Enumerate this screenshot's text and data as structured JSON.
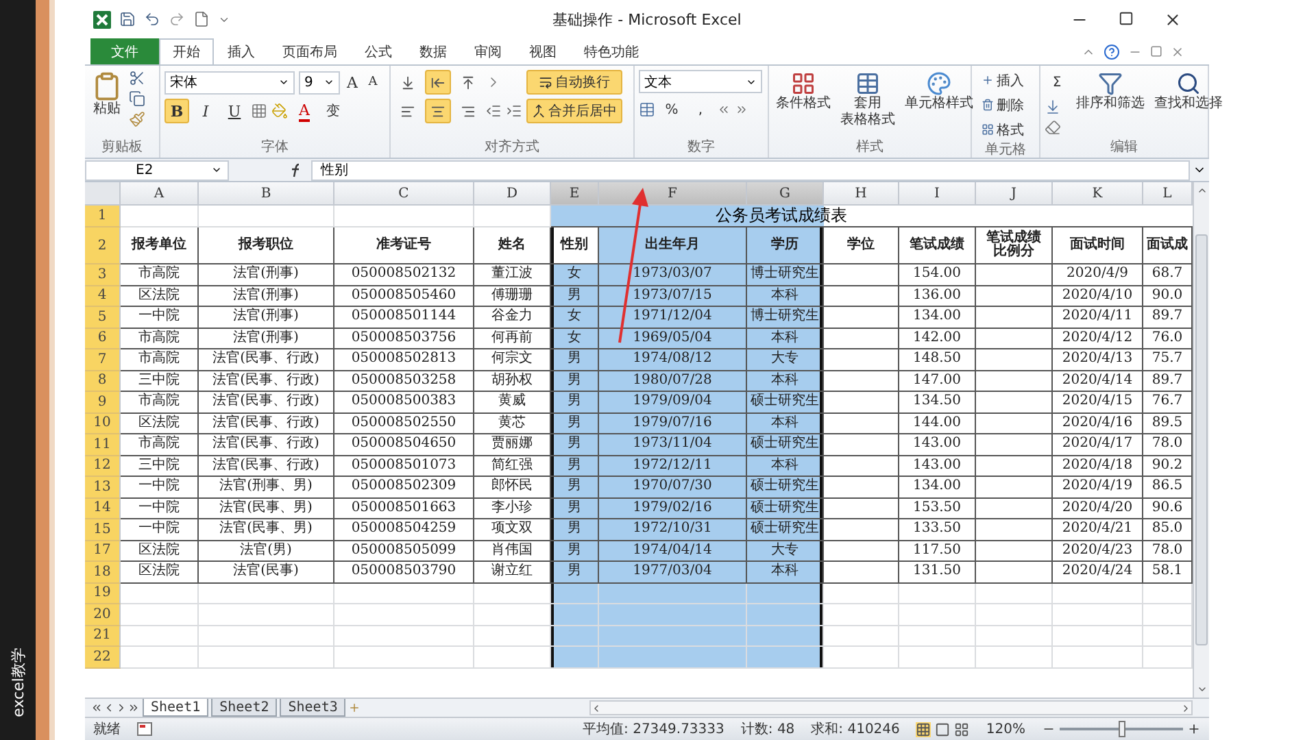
{
  "side_label": "excel教学",
  "window": {
    "title": "基础操作 - Microsoft Excel"
  },
  "ribbon": {
    "tabs": [
      {
        "label": "文件",
        "kind": "file",
        "selected": false
      },
      {
        "label": "开始",
        "kind": "tab",
        "selected": true
      },
      {
        "label": "插入",
        "kind": "tab",
        "selected": false
      },
      {
        "label": "页面布局",
        "kind": "tab",
        "selected": false
      },
      {
        "label": "公式",
        "kind": "tab",
        "selected": false
      },
      {
        "label": "数据",
        "kind": "tab",
        "selected": false
      },
      {
        "label": "审阅",
        "kind": "tab",
        "selected": false
      },
      {
        "label": "视图",
        "kind": "tab",
        "selected": false
      },
      {
        "label": "特色功能",
        "kind": "tab",
        "selected": false
      }
    ],
    "clipboard": {
      "label": "剪贴板",
      "paste": "粘贴"
    },
    "font": {
      "label": "字体",
      "face": "宋体",
      "size": "9",
      "size_buttons": [
        "A",
        "A"
      ],
      "styles": [
        {
          "text": "B",
          "on": true
        },
        {
          "text": "I",
          "on": false
        },
        {
          "text": "U",
          "on": false
        }
      ],
      "font_color": "A",
      "phonetic": "变"
    },
    "alignment": {
      "label": "对齐方式",
      "vertical": [
        {
          "on": false
        },
        {
          "on": true
        },
        {
          "on": false
        }
      ],
      "horizontal": [
        {
          "on": false
        },
        {
          "on": true
        },
        {
          "on": false
        }
      ],
      "wrap": {
        "text": "自动换行",
        "on": true
      },
      "merge": {
        "text": "合并后居中",
        "on": true
      }
    },
    "number": {
      "label": "数字",
      "format": "文本",
      "symbols": [
        "%",
        ","
      ]
    },
    "styles": {
      "label": "样式",
      "buttons": [
        "条件格式",
        [
          "套用",
          "表格格式"
        ],
        "单元格样式"
      ]
    },
    "cells": {
      "label": "单元格",
      "buttons": [
        "插入",
        "删除",
        "格式"
      ]
    },
    "editing": {
      "label": "编辑",
      "sum": "Σ",
      "buttons": [
        "排序和筛选",
        "查找和选择"
      ]
    }
  },
  "formula_bar": {
    "name_box": "E2",
    "formula": "性别"
  },
  "sheet": {
    "columns": [
      {
        "letter": "A",
        "selected": false
      },
      {
        "letter": "B",
        "selected": false
      },
      {
        "letter": "C",
        "selected": false
      },
      {
        "letter": "D",
        "selected": false
      },
      {
        "letter": "E",
        "selected": true,
        "active": true
      },
      {
        "letter": "F",
        "selected": true
      },
      {
        "letter": "G",
        "selected": true
      },
      {
        "letter": "H",
        "selected": false
      },
      {
        "letter": "I",
        "selected": false
      },
      {
        "letter": "J",
        "selected": false
      },
      {
        "letter": "K",
        "selected": false
      },
      {
        "letter": "L",
        "selected": false
      }
    ],
    "rows": [
      {
        "number": "1",
        "selected": true,
        "title": "公务员考试成绩表"
      },
      {
        "number": "2",
        "selected": true,
        "active": true,
        "kind": "header",
        "cells": [
          "报考单位",
          "报考职位",
          "准考证号",
          "姓名",
          "性别",
          "出生年月",
          "学历",
          "学位",
          "笔试成绩",
          [
            "笔试成绩",
            "比例分"
          ],
          "面试时间",
          "面试成"
        ]
      },
      {
        "number": "3",
        "selected": true,
        "cells": [
          "市高院",
          "法官(刑事)",
          "050008502132",
          "董江波",
          "女",
          "1973/03/07",
          "博士研究生",
          null,
          "154.00",
          null,
          "2020/4/9",
          "68.7"
        ]
      },
      {
        "number": "4",
        "selected": true,
        "cells": [
          "区法院",
          "法官(刑事)",
          "050008505460",
          "傅珊珊",
          "男",
          "1973/07/15",
          "本科",
          null,
          "136.00",
          null,
          "2020/4/10",
          "90.0"
        ]
      },
      {
        "number": "5",
        "selected": true,
        "cells": [
          "一中院",
          "法官(刑事)",
          "050008501144",
          "谷金力",
          "女",
          "1971/12/04",
          "博士研究生",
          null,
          "134.00",
          null,
          "2020/4/11",
          "89.7"
        ]
      },
      {
        "number": "6",
        "selected": true,
        "cells": [
          "市高院",
          "法官(刑事)",
          "050008503756",
          "何再前",
          "女",
          "1969/05/04",
          "本科",
          null,
          "142.00",
          null,
          "2020/4/12",
          "76.0"
        ]
      },
      {
        "number": "7",
        "selected": true,
        "cells": [
          "市高院",
          "法官(民事、行政)",
          "050008502813",
          "何宗文",
          "男",
          "1974/08/12",
          "大专",
          null,
          "148.50",
          null,
          "2020/4/13",
          "75.7"
        ]
      },
      {
        "number": "8",
        "selected": true,
        "cells": [
          "三中院",
          "法官(民事、行政)",
          "050008503258",
          "胡孙权",
          "男",
          "1980/07/28",
          "本科",
          null,
          "147.00",
          null,
          "2020/4/14",
          "89.7"
        ]
      },
      {
        "number": "9",
        "selected": true,
        "cells": [
          "市高院",
          "法官(民事、行政)",
          "050008500383",
          "黄威",
          "男",
          "1979/09/04",
          "硕士研究生",
          null,
          "134.50",
          null,
          "2020/4/15",
          "76.7"
        ]
      },
      {
        "number": "10",
        "selected": true,
        "cells": [
          "区法院",
          "法官(民事、行政)",
          "050008502550",
          "黄芯",
          "男",
          "1979/07/16",
          "本科",
          null,
          "144.00",
          null,
          "2020/4/16",
          "89.5"
        ]
      },
      {
        "number": "11",
        "selected": true,
        "cells": [
          "市高院",
          "法官(民事、行政)",
          "050008504650",
          "贾丽娜",
          "男",
          "1973/11/04",
          "硕士研究生",
          null,
          "143.00",
          null,
          "2020/4/17",
          "78.0"
        ]
      },
      {
        "number": "12",
        "selected": true,
        "cells": [
          "三中院",
          "法官(民事、行政)",
          "050008501073",
          "简红强",
          "男",
          "1972/12/11",
          "本科",
          null,
          "143.00",
          null,
          "2020/4/18",
          "90.2"
        ]
      },
      {
        "number": "13",
        "selected": true,
        "cells": [
          "一中院",
          "法官(刑事、男)",
          "050008502309",
          "郎怀民",
          "男",
          "1970/07/30",
          "硕士研究生",
          null,
          "134.00",
          null,
          "2020/4/19",
          "86.5"
        ]
      },
      {
        "number": "14",
        "selected": true,
        "cells": [
          "一中院",
          "法官(民事、男)",
          "050008501663",
          "李小珍",
          "男",
          "1979/02/16",
          "硕士研究生",
          null,
          "153.50",
          null,
          "2020/4/20",
          "90.6"
        ]
      },
      {
        "number": "15",
        "selected": true,
        "cells": [
          "一中院",
          "法官(民事、男)",
          "050008504259",
          "项文双",
          "男",
          "1972/10/31",
          "硕士研究生",
          null,
          "133.50",
          null,
          "2020/4/21",
          "85.0"
        ]
      },
      {
        "number": "17",
        "selected": true,
        "cells": [
          "区法院",
          "法官(男)",
          "050008505099",
          "肖伟国",
          "男",
          "1974/04/14",
          "大专",
          null,
          "117.50",
          null,
          "2020/4/23",
          "78.0"
        ]
      },
      {
        "number": "18",
        "selected": true,
        "cells": [
          "区法院",
          "法官(民事)",
          "050008503790",
          "谢立红",
          "男",
          "1977/03/04",
          "本科",
          null,
          "131.50",
          null,
          "2020/4/24",
          "58.1"
        ]
      },
      {
        "number": "19",
        "selected": true
      },
      {
        "number": "20",
        "selected": true
      },
      {
        "number": "21",
        "selected": true
      },
      {
        "number": "22",
        "selected": true
      }
    ]
  },
  "sheet_tabs": [
    {
      "label": "Sheet1",
      "selected": true
    },
    {
      "label": "Sheet2",
      "selected": false
    },
    {
      "label": "Sheet3",
      "selected": false
    }
  ],
  "status_bar": {
    "mode": "就绪",
    "average": "平均值: 27349.73333",
    "count": "计数: 48",
    "sum": "求和: 410246",
    "zoom": "120%",
    "zoom_slider": {
      "level": 0.5
    }
  }
}
